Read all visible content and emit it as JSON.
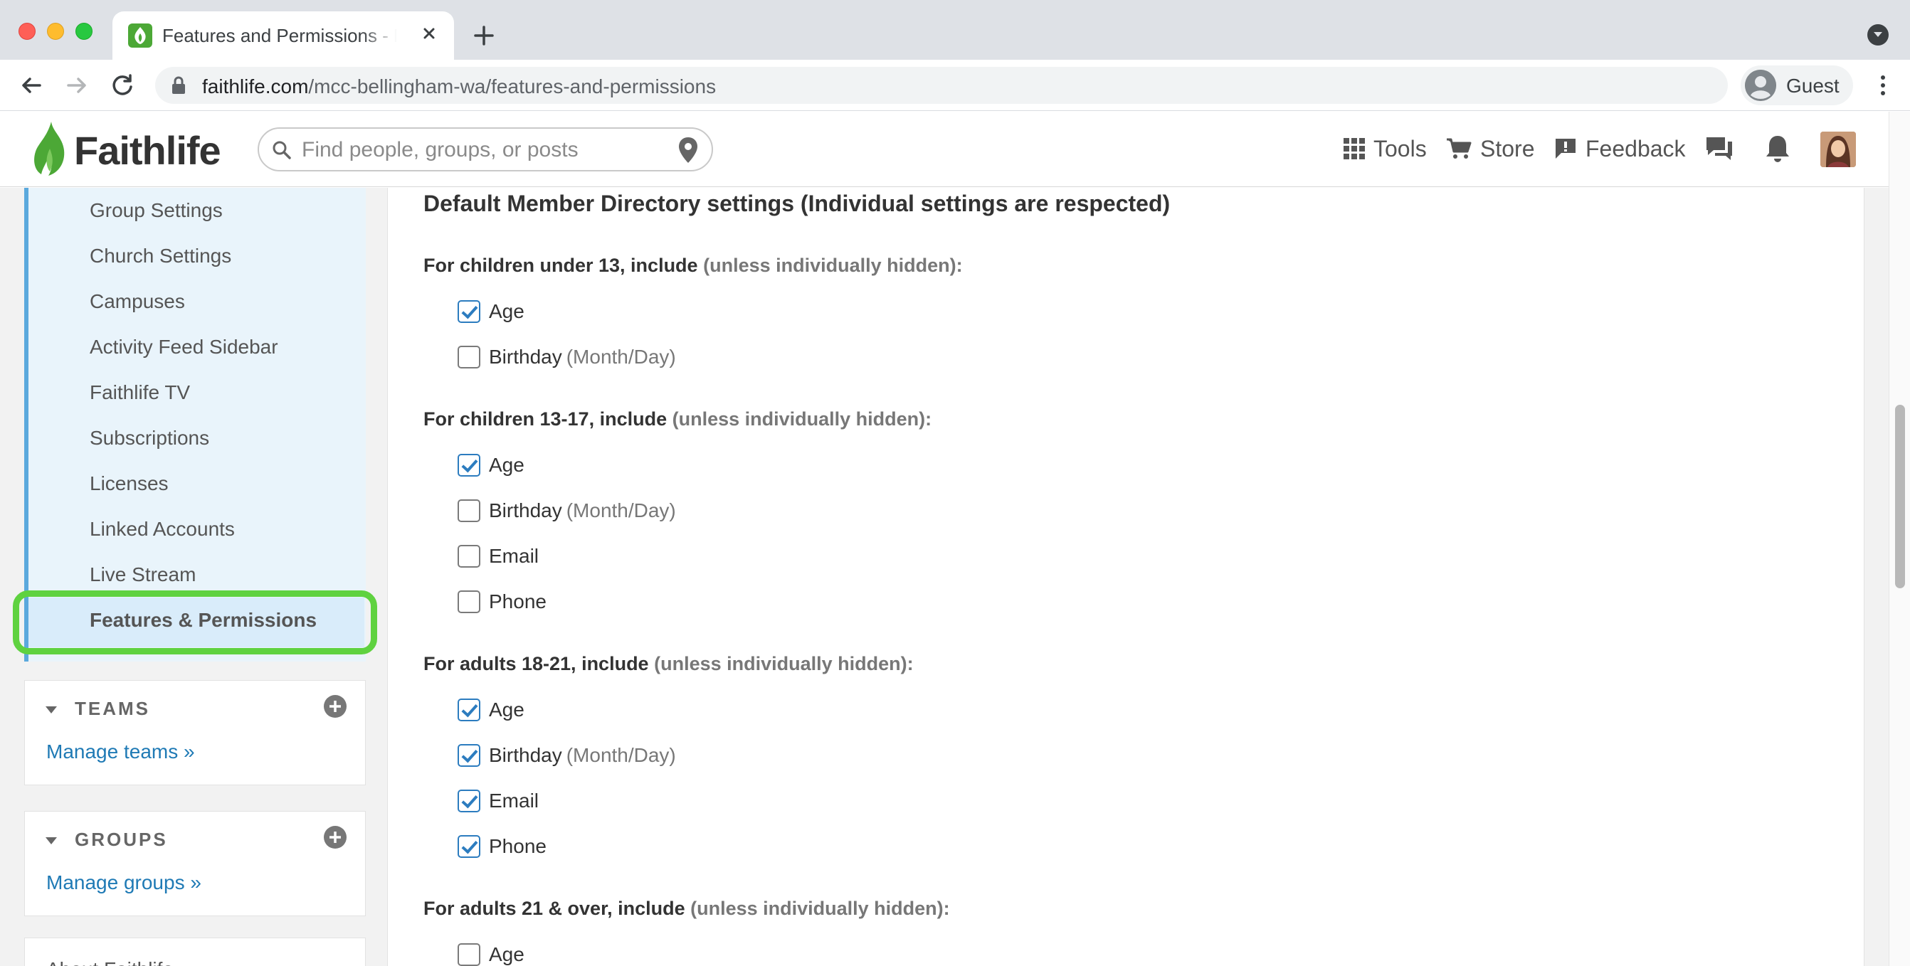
{
  "browser": {
    "tab_title": "Features and Permissions - Manage Group",
    "url_domain": "faithlife.com",
    "url_path": "/mcc-bellingham-wa/features-and-permissions",
    "profile_name": "Guest"
  },
  "header": {
    "logo_text": "Faithlife",
    "search_placeholder": "Find people, groups, or posts",
    "nav": {
      "tools": "Tools",
      "store": "Store",
      "feedback": "Feedback"
    }
  },
  "sidebar": {
    "items": [
      "Group Settings",
      "Church Settings",
      "Campuses",
      "Activity Feed Sidebar",
      "Faithlife TV",
      "Subscriptions",
      "Licenses",
      "Linked Accounts",
      "Live Stream",
      "Features & Permissions"
    ],
    "teams": {
      "title": "TEAMS",
      "link": "Manage teams »"
    },
    "groups": {
      "title": "GROUPS",
      "link": "Manage groups »"
    },
    "about": {
      "title": "About Faithlife"
    }
  },
  "main": {
    "heading": "Default Member Directory settings (Individual settings are respected)",
    "suffix": "(unless individually hidden):",
    "groups": [
      {
        "label": "For children under 13, include",
        "options": [
          {
            "label": "Age",
            "checked": true
          },
          {
            "label": "Birthday",
            "note": "(Month/Day)",
            "checked": false
          }
        ]
      },
      {
        "label": "For children 13-17, include",
        "options": [
          {
            "label": "Age",
            "checked": true
          },
          {
            "label": "Birthday",
            "note": "(Month/Day)",
            "checked": false
          },
          {
            "label": "Email",
            "checked": false
          },
          {
            "label": "Phone",
            "checked": false
          }
        ]
      },
      {
        "label": "For adults 18-21, include",
        "options": [
          {
            "label": "Age",
            "checked": true
          },
          {
            "label": "Birthday",
            "note": "(Month/Day)",
            "checked": true
          },
          {
            "label": "Email",
            "checked": true
          },
          {
            "label": "Phone",
            "checked": true
          }
        ]
      },
      {
        "label": "For adults 21 & over, include",
        "options": [
          {
            "label": "Age",
            "checked": false
          }
        ]
      }
    ]
  },
  "colors": {
    "accent_blue": "#2c7cbf",
    "highlight_green": "#5fd240",
    "link_blue": "#1f7ab5",
    "sidebar_bg": "#e9f4fb"
  }
}
